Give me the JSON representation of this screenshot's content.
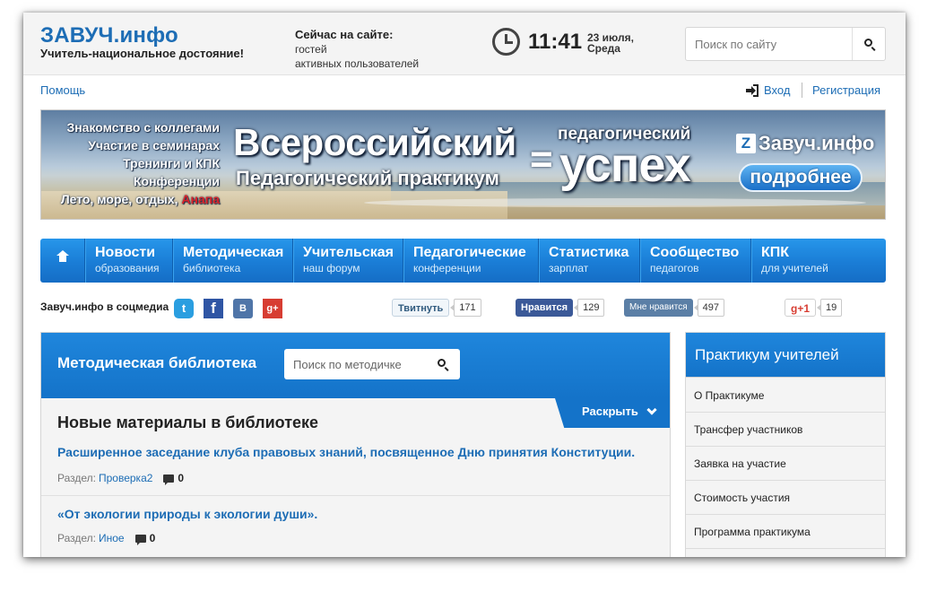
{
  "header": {
    "logo": "ЗАВУЧ.инфо",
    "tagline": "Учитель-национальное достояние!",
    "online_title": "Сейчас на сайте:",
    "online_guests": "гостей",
    "online_users": "активных пользователей",
    "time": "11:41",
    "date_line1": "23 июля,",
    "date_line2": "Среда",
    "search_placeholder": "Поиск по сайту"
  },
  "utility": {
    "help": "Помощь",
    "login": "Вход",
    "register": "Регистрация"
  },
  "banner": {
    "left_lines": [
      "Знакомство с коллегами",
      "Участие в семинарах",
      "Тренинги и КПК",
      "Конференции"
    ],
    "left_last": "Лето, море, отдых, ",
    "left_last_red": "Анапа",
    "title_big": "Всероссийский",
    "title_sub": "Педагогический практикум",
    "equals": "=",
    "result_small": "педагогический",
    "result_big": "успех",
    "brand": "Завуч.инфо",
    "brand_badge": "Z",
    "button": "подробнее"
  },
  "nav": {
    "items": [
      {
        "title": "Новости",
        "sub": "образования"
      },
      {
        "title": "Методическая",
        "sub": "библиотека"
      },
      {
        "title": "Учительская",
        "sub": "наш форум"
      },
      {
        "title": "Педагогические",
        "sub": "конференции"
      },
      {
        "title": "Статистика",
        "sub": "зарплат"
      },
      {
        "title": "Сообщество",
        "sub": "педагогов"
      },
      {
        "title": "КПК",
        "sub": "для учителей"
      }
    ]
  },
  "social": {
    "label": "Завуч.инфо в соцмедиа",
    "icons": {
      "twitter": "t",
      "facebook": "f",
      "vk": "В",
      "gplus": "g+"
    },
    "tweet": {
      "label": "Твитнуть",
      "count": "171"
    },
    "fb_like": {
      "label": "Нравится",
      "count": "129"
    },
    "vk_like": {
      "label": "Мне нравится",
      "count": "497"
    },
    "gplus": {
      "label": "g+1",
      "count": "19"
    }
  },
  "library": {
    "title": "Методическая библиотека",
    "search_placeholder": "Поиск по методичке",
    "expand": "Раскрыть",
    "subtitle": "Новые материалы в библиотеке",
    "section_label": "Раздел:",
    "entries": [
      {
        "title": "Расширенное заседание клуба правовых знаний, посвященное Дню принятия Конституции.",
        "section": "Проверка2",
        "comments": "0"
      },
      {
        "title": "«От экологии природы к экологии души».",
        "section": "Иное",
        "comments": "0"
      }
    ]
  },
  "sidebar": {
    "title": "Практикум учителей",
    "items": [
      "О Практикуме",
      "Трансфер участников",
      "Заявка на участие",
      "Стоимость участия",
      "Программа практикума"
    ]
  }
}
